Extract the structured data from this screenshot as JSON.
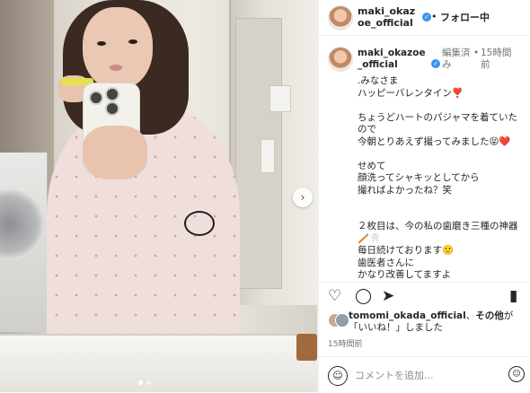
{
  "header": {
    "username": "maki_okazoe_official",
    "follow_separator": "•",
    "follow_label": "フォロー中"
  },
  "post": {
    "username": "maki_okazoe_official",
    "edited_label": "編集済み",
    "separator": "•",
    "time": "15時間前",
    "caption": ".みなさま\nハッピーバレンタイン❣️\n\nちょうどハートのパジャマを着ていたので\n今朝とりあえず撮ってみました😝❤️\n\nせめて\n顔洗ってシャキッとしてから\n撮ればよかったね？笑\n\n\n２枚目は、今の私の歯磨き三種の神器🪥🦷\n毎日続けております🙂\n歯医者さんに\nかなり改善してますよ\n..."
  },
  "likes": {
    "user": "tomomi_okada_official",
    "separator": "、",
    "others": "その他",
    "suffix": "が「いいね！」しました"
  },
  "footer": {
    "time": "15時間前",
    "comment_placeholder": "コメントを追加..."
  },
  "icons": {
    "heart": "heart-icon",
    "comment": "comment-icon",
    "share": "share-icon",
    "save": "bookmark-icon",
    "more": "more-icon",
    "next": "chevron-right-icon",
    "emoji": "emoji-icon"
  },
  "colors": {
    "verified": "#3897f0",
    "text": "#262626",
    "muted": "#737373"
  }
}
